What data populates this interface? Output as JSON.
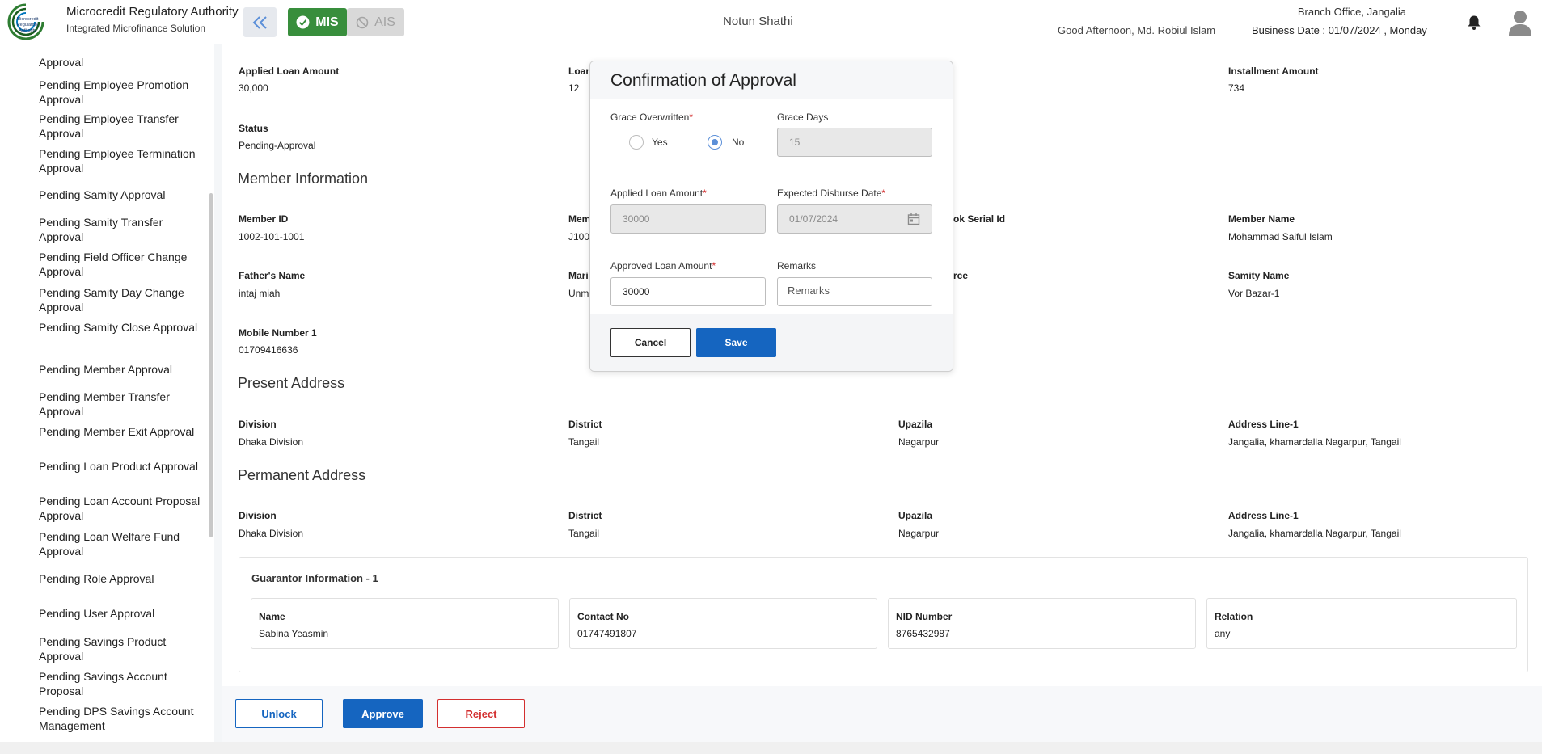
{
  "header": {
    "brand_title": "Microcredit Regulatory Authority",
    "brand_subtitle": "Integrated Microfinance Solution",
    "logo_text": "Microcredit Regulatory Authority",
    "mis_label": "MIS",
    "ais_label": "AIS",
    "app_name": "Notun Shathi",
    "greeting": "Good Afternoon, Md. Robiul Islam",
    "branch": "Branch Office, Jangalia",
    "business_date": "Business Date : 01/07/2024 , Monday"
  },
  "sidebar": {
    "items": [
      {
        "label": "Approval"
      },
      {
        "label": "Pending Employee Promotion Approval"
      },
      {
        "label": "Pending Employee Transfer Approval"
      },
      {
        "label": "Pending Employee Termination Approval"
      },
      {
        "label": "Pending Samity Approval"
      },
      {
        "label": "Pending Samity Transfer Approval"
      },
      {
        "label": "Pending Field Officer Change Approval"
      },
      {
        "label": "Pending Samity Day Change Approval"
      },
      {
        "label": "Pending Samity Close Approval"
      },
      {
        "label": "Pending Member Approval"
      },
      {
        "label": "Pending Member Transfer Approval"
      },
      {
        "label": "Pending Member Exit Approval"
      },
      {
        "label": "Pending Loan Product Approval"
      },
      {
        "label": "Pending Loan Account Proposal Approval"
      },
      {
        "label": "Pending Loan Welfare Fund Approval"
      },
      {
        "label": "Pending Role Approval"
      },
      {
        "label": "Pending User Approval"
      },
      {
        "label": "Pending Savings Product Approval"
      },
      {
        "label": "Pending Savings Account Proposal"
      },
      {
        "label": "Pending DPS Savings Account Management"
      }
    ]
  },
  "loan": {
    "applied_amount_label": "Applied Loan Amount",
    "applied_amount_value": "30,000",
    "loan_col2_label": "Loan",
    "loan_col2_value": "12",
    "installment_label": "Installment Amount",
    "installment_value": "734",
    "status_label": "Status",
    "status_value": "Pending-Approval"
  },
  "member": {
    "section_title": "Member Information",
    "member_id_label": "Member ID",
    "member_id_value": "1002-101-1001",
    "col2_label": "Mem",
    "col2_value": "J100",
    "passbook_label": "ok Serial Id",
    "member_name_label": "Member Name",
    "member_name_value": "Mohammad Saiful Islam",
    "father_label": "Father's Name",
    "father_value": "intaj miah",
    "marital_label": "Mari",
    "marital_value": "Unm",
    "source_label": "rce",
    "samity_label": "Samity Name",
    "samity_value": "Vor Bazar-1",
    "mobile_label": "Mobile Number 1",
    "mobile_value": "01709416636"
  },
  "present_address": {
    "section_title": "Present Address",
    "division_label": "Division",
    "division_value": "Dhaka Division",
    "district_label": "District",
    "district_value": "Tangail",
    "upazila_label": "Upazila",
    "upazila_value": "Nagarpur",
    "address_label": "Address Line-1",
    "address_value": "Jangalia, khamardalla,Nagarpur, Tangail"
  },
  "permanent_address": {
    "section_title": "Permanent Address",
    "division_label": "Division",
    "division_value": "Dhaka Division",
    "district_label": "District",
    "district_value": "Tangail",
    "upazila_label": "Upazila",
    "upazila_value": "Nagarpur",
    "address_label": "Address Line-1",
    "address_value": "Jangalia, khamardalla,Nagarpur, Tangail"
  },
  "guarantor": {
    "title": "Guarantor Information - 1",
    "name_label": "Name",
    "name_value": "Sabina Yeasmin",
    "contact_label": "Contact No",
    "contact_value": "01747491807",
    "nid_label": "NID Number",
    "nid_value": "8765432987",
    "relation_label": "Relation",
    "relation_value": "any"
  },
  "actions": {
    "unlock": "Unlock",
    "approve": "Approve",
    "reject": "Reject"
  },
  "modal": {
    "title": "Confirmation of Approval",
    "grace_overwritten_label": "Grace Overwritten",
    "yes_label": "Yes",
    "no_label": "No",
    "selected_option": "No",
    "grace_days_label": "Grace Days",
    "grace_days_value": "15",
    "applied_amount_label": "Applied Loan Amount",
    "applied_amount_value": "30000",
    "expected_date_label": "Expected Disburse Date",
    "expected_date_value": "01/07/2024",
    "approved_amount_label": "Approved Loan Amount",
    "approved_amount_value": "30000",
    "remarks_label": "Remarks",
    "remarks_placeholder": "Remarks",
    "cancel": "Cancel",
    "save": "Save",
    "required_mark": "*"
  },
  "colors": {
    "primary": "#1565c0",
    "mis_green": "#388e3c",
    "danger": "#d32f2f"
  }
}
